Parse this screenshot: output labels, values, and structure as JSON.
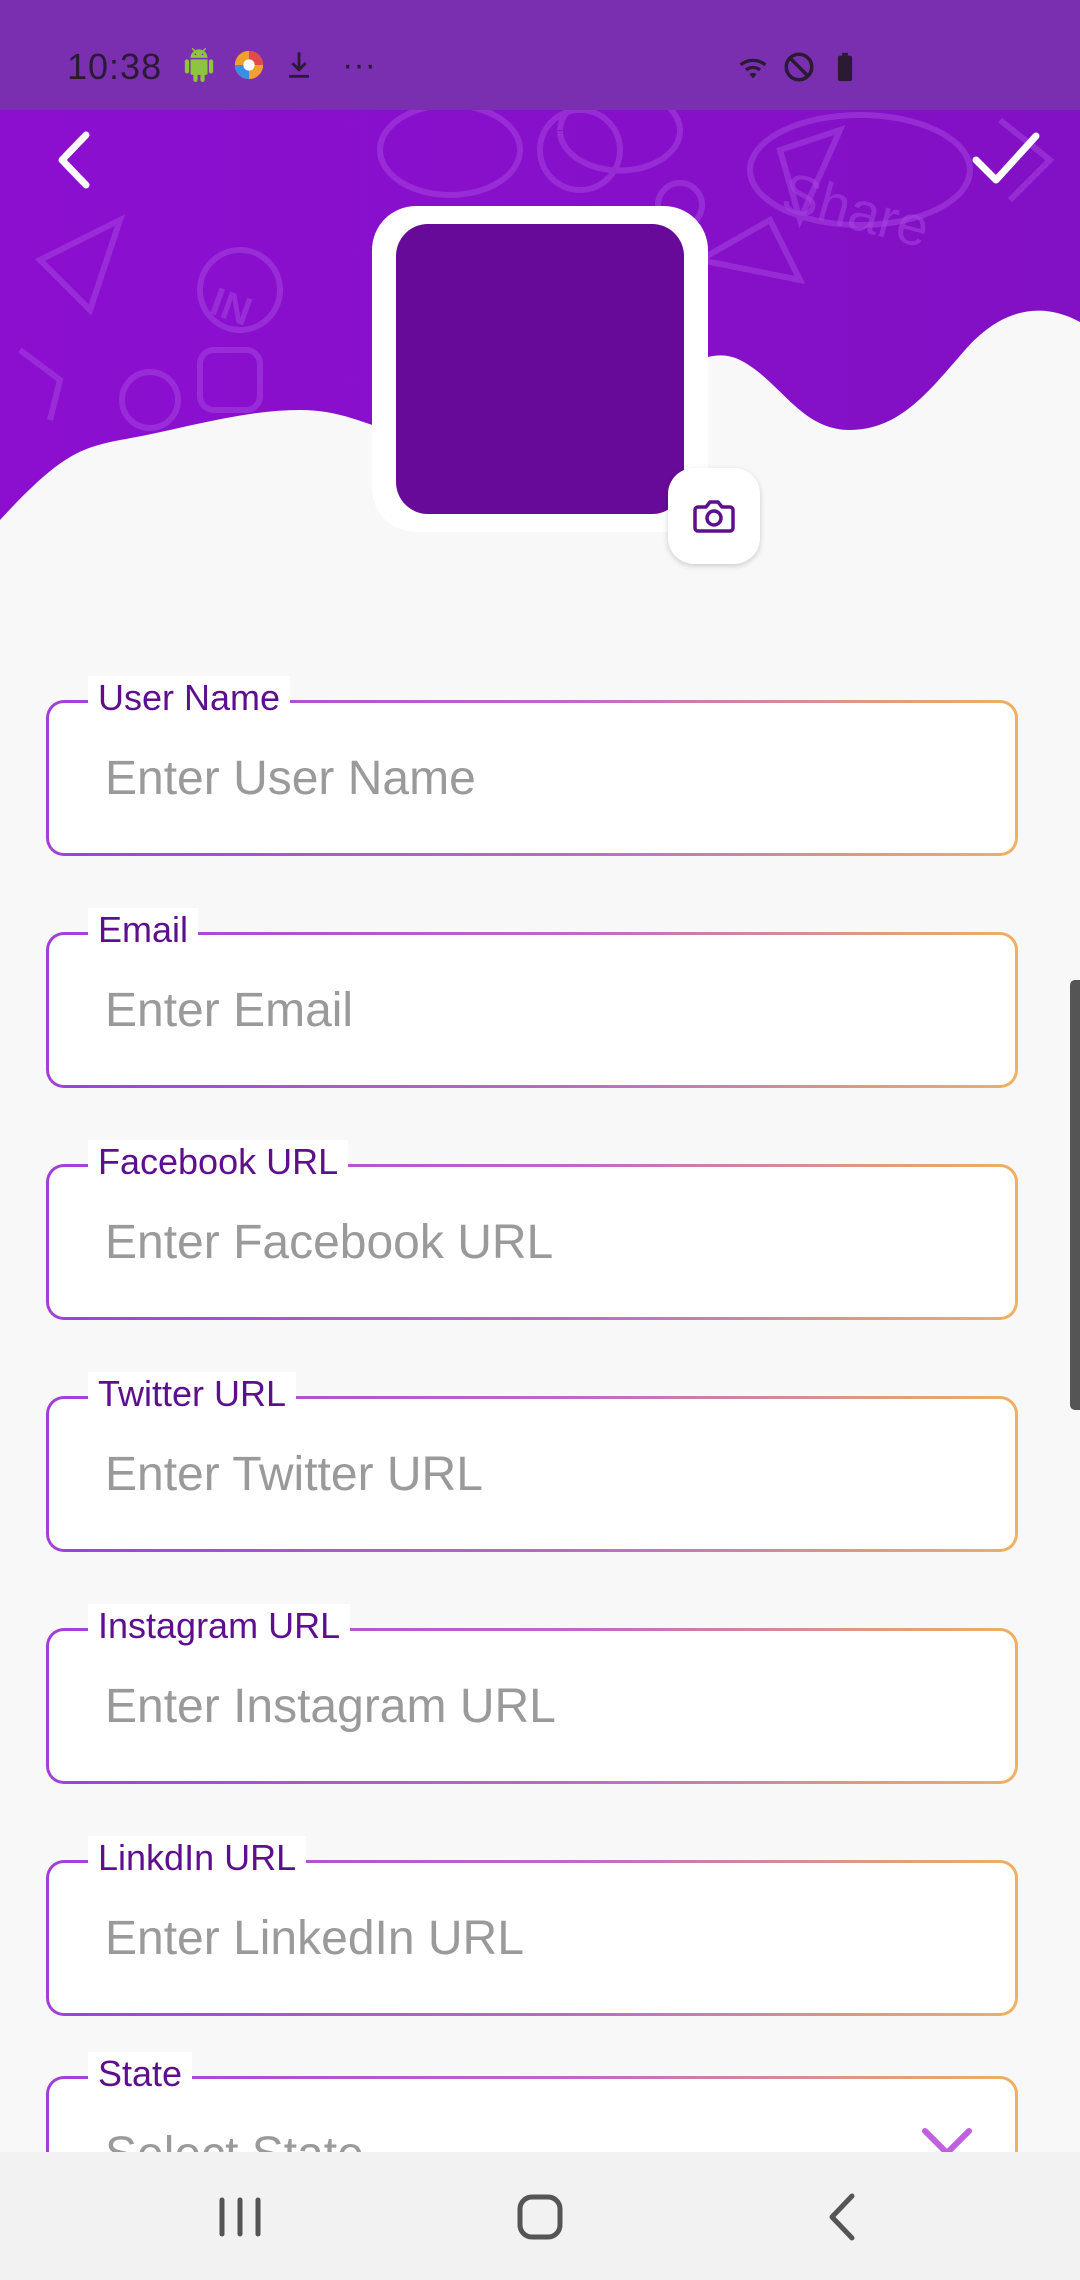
{
  "status_bar": {
    "time": "10:38",
    "left_icons": [
      "android-icon",
      "browser-icon",
      "download-icon",
      "more-dots-icon"
    ],
    "right_icons": [
      "wifi-icon",
      "dnd-icon",
      "battery-icon"
    ],
    "more": "···"
  },
  "header": {
    "back_icon": "chevron-left-icon",
    "save_icon": "check-icon",
    "accent_color": "#8a10c8",
    "avatar_color": "#680a99"
  },
  "form": {
    "fields": [
      {
        "label": "User Name",
        "placeholder": "Enter User Name"
      },
      {
        "label": "Email",
        "placeholder": "Enter Email"
      },
      {
        "label": "Facebook URL",
        "placeholder": "Enter Facebook URL"
      },
      {
        "label": "Twitter URL",
        "placeholder": "Enter Twitter URL"
      },
      {
        "label": "Instagram URL",
        "placeholder": "Enter Instagram URL"
      },
      {
        "label": "LinkdIn URL",
        "placeholder": "Enter LinkedIn URL"
      },
      {
        "label": "State",
        "placeholder": "Select State"
      }
    ]
  },
  "nav": {
    "icons": [
      "recent-apps-icon",
      "home-icon",
      "back-icon"
    ]
  }
}
